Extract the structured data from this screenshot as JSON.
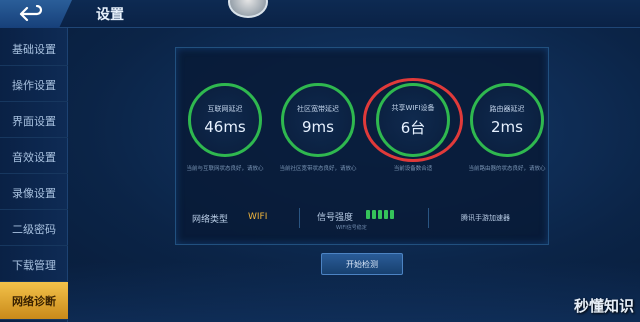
{
  "header": {
    "title": "设置"
  },
  "sidebar": {
    "items": [
      {
        "label": "基础设置"
      },
      {
        "label": "操作设置"
      },
      {
        "label": "界面设置"
      },
      {
        "label": "音效设置"
      },
      {
        "label": "录像设置"
      },
      {
        "label": "二级密码"
      },
      {
        "label": "下载管理"
      },
      {
        "label": "网络诊断"
      }
    ],
    "active_index": 7
  },
  "metrics": [
    {
      "label": "互联网延迟",
      "value": "46ms",
      "desc": "当前与互联网状态良好，请放心"
    },
    {
      "label": "社区宽带延迟",
      "value": "9ms",
      "desc": "当前社区宽带状态良好，请放心"
    },
    {
      "label": "共享WIFI设备",
      "value": "6台",
      "desc": "当前设备数合适"
    },
    {
      "label": "路由器延迟",
      "value": "2ms",
      "desc": "当前路由器的状态良好，请放心"
    }
  ],
  "info": {
    "network_type_label": "网络类型",
    "network_type_value": "WIFI",
    "signal_label": "信号强度",
    "signal_sub": "WIFI信号稳定",
    "accelerator_label": "腾讯手游加速器"
  },
  "actions": {
    "start_check": "开始检测"
  },
  "watermark": "秒懂知识",
  "colors": {
    "ring_green": "#2fb84f",
    "highlight_red": "#e03a3a",
    "active_tab": "#f3c24a",
    "wifi_orange": "#f0b43c"
  }
}
